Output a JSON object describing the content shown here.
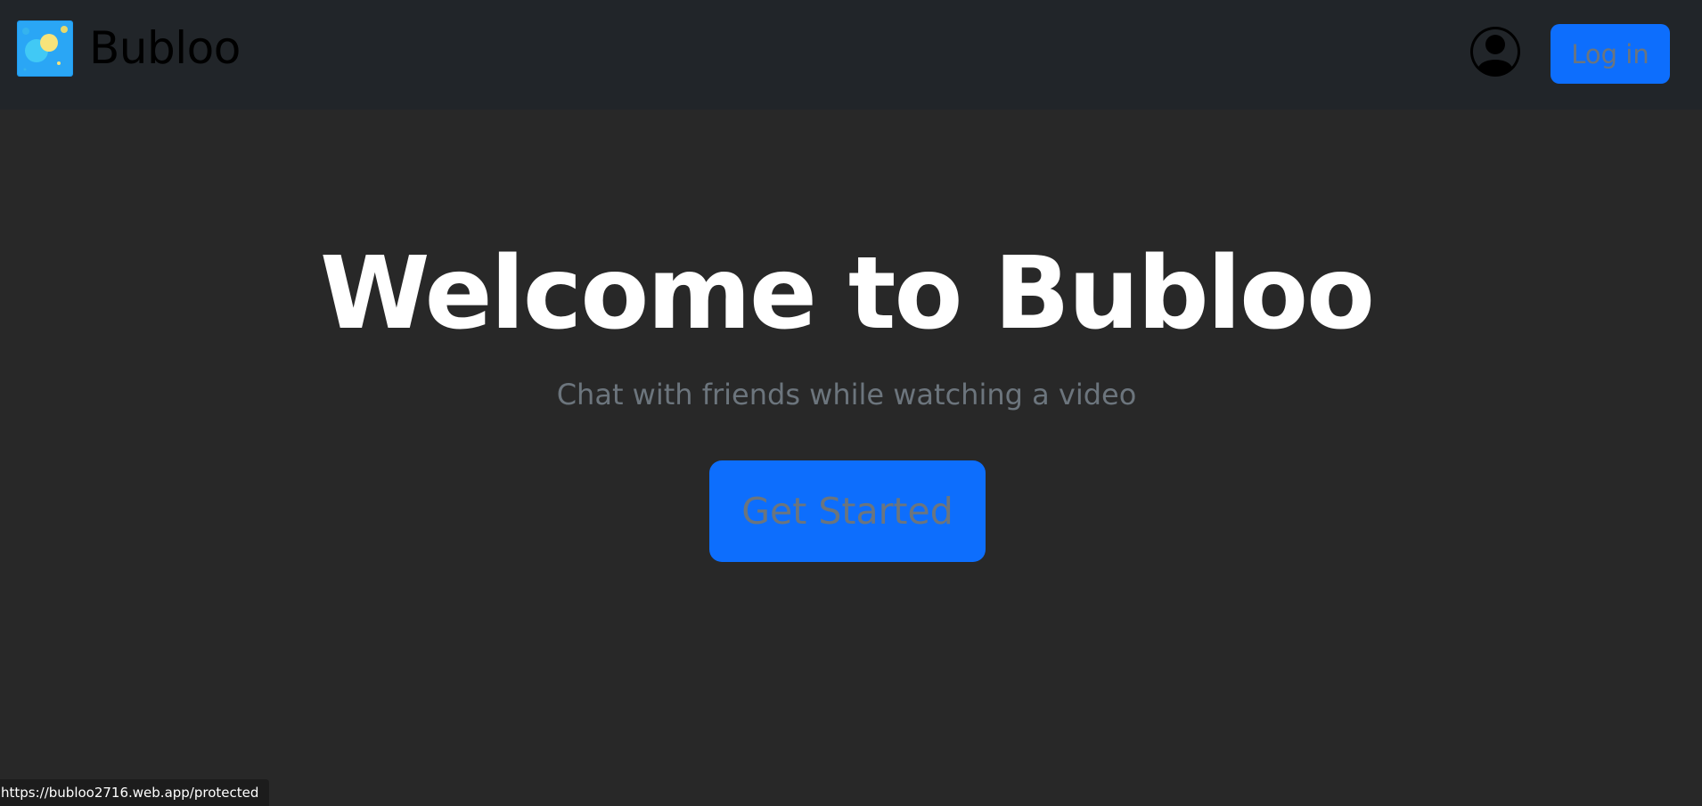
{
  "navbar": {
    "brand_name": "Bubloo",
    "logo_icon": "bubbles-logo-icon",
    "profile_icon": "user-circle-icon",
    "login_label": "Log in"
  },
  "hero": {
    "title": "Welcome to Bubloo",
    "subtitle": "Chat with friends while watching a video",
    "cta_label": "Get Started"
  },
  "status_bar": {
    "url": "https://bubloo2716.web.app/protected"
  },
  "colors": {
    "page_background": "#282828",
    "navbar_background": "#212529",
    "primary_button": "#0d6efd",
    "muted_text": "#6c757d",
    "title_text": "#ffffff"
  }
}
